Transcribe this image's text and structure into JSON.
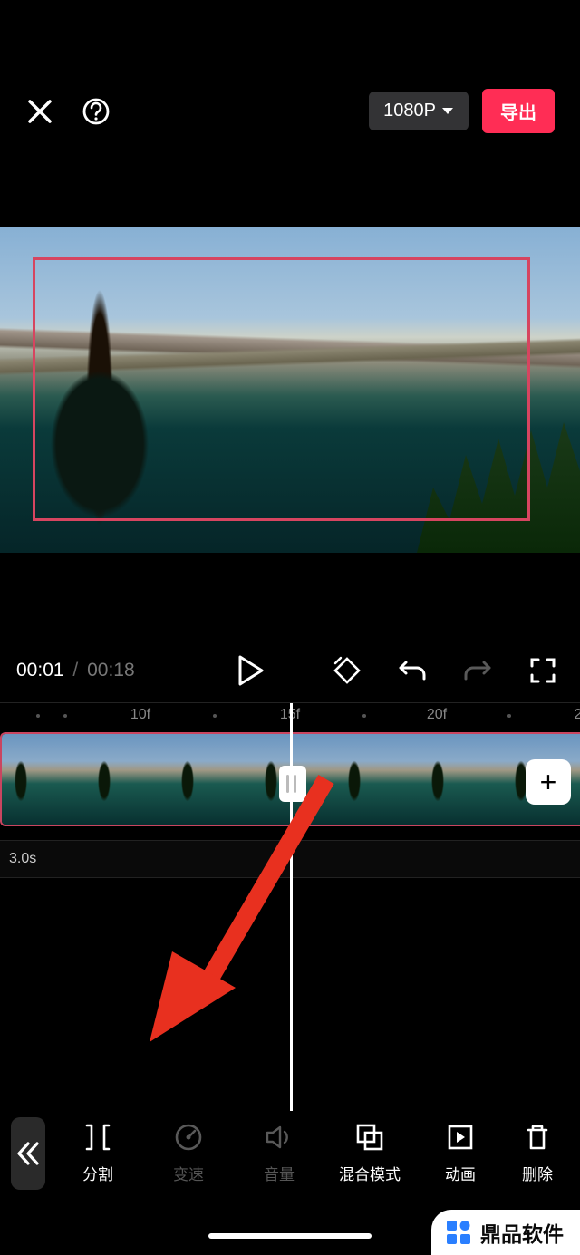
{
  "header": {
    "resolution_label": "1080P",
    "export_label": "导出"
  },
  "playback": {
    "current_time": "00:01",
    "separator": "/",
    "duration": "00:18"
  },
  "timeline": {
    "ruler": {
      "tick1": "10f",
      "tick2": "15f",
      "tick3": "20f"
    },
    "track2_duration": "3.0s",
    "add_label": "+"
  },
  "toolbar": {
    "items": [
      {
        "label": "分割"
      },
      {
        "label": "变速"
      },
      {
        "label": "音量"
      },
      {
        "label": "混合模式"
      },
      {
        "label": "动画"
      },
      {
        "label": "删除"
      }
    ]
  },
  "watermark": {
    "brand": "鼎品软件"
  }
}
